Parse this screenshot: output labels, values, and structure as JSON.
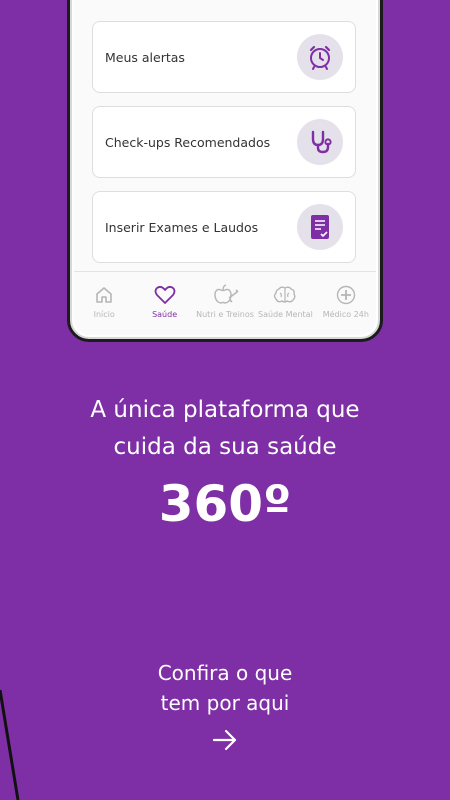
{
  "cards": [
    {
      "label": "Meus alertas",
      "icon": "alarm-clock-icon"
    },
    {
      "label": "Check-ups Recomendados",
      "icon": "stethoscope-icon"
    },
    {
      "label": "Inserir Exames e Laudos",
      "icon": "document-check-icon"
    }
  ],
  "nav": [
    {
      "label": "Início",
      "icon": "home-icon",
      "active": false
    },
    {
      "label": "Saúde",
      "icon": "heart-icon",
      "active": true
    },
    {
      "label": "Nutri e Treinos",
      "icon": "apple-dumbbell-icon",
      "active": false
    },
    {
      "label": "Saúde Mental",
      "icon": "brain-icon",
      "active": false
    },
    {
      "label": "Médico 24h",
      "icon": "medical-plus-icon",
      "active": false
    }
  ],
  "headline": {
    "line1": "A única plataforma que",
    "line2": "cuida da sua saúde"
  },
  "big_number": "360º",
  "cta": {
    "line1": "Confira o que",
    "line2": "tem por aqui"
  },
  "colors": {
    "background": "#7f2fa6",
    "accent": "#7f2fa6",
    "icon_circle": "#e5e1ea"
  }
}
